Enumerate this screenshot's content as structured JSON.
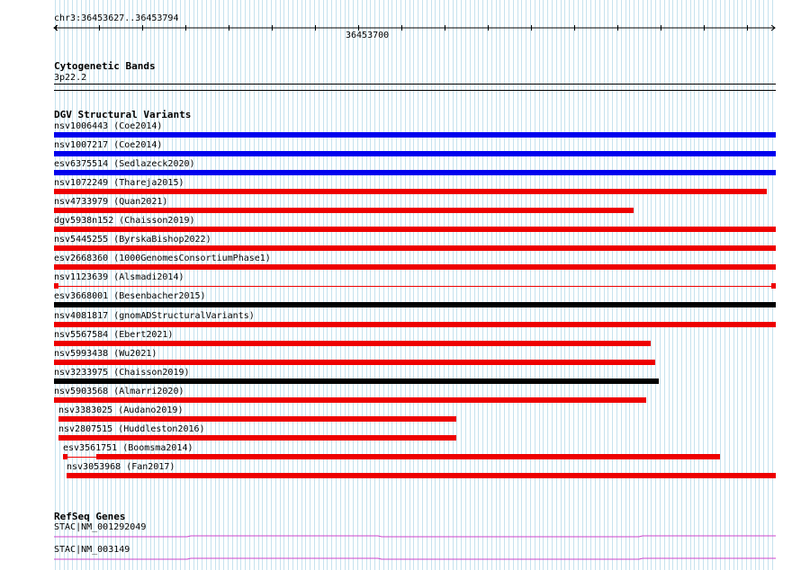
{
  "ruler": {
    "region": "chr3:36453627..36453794",
    "center_tick_label": "36453700"
  },
  "colors": {
    "grid_line": "#c6e2ee",
    "gain_blue": "#0000ee",
    "loss_red": "#ee0000",
    "complex_black": "#000000",
    "gene_magenta": "#cc44cc"
  },
  "cytoband_track": {
    "title": "Cytogenetic Bands",
    "band": "3p22.2"
  },
  "dgv_track": {
    "title": "DGV Structural Variants",
    "variants": [
      {
        "label": "nsv1006443 (Coe2014)",
        "start": 36453627,
        "end": 36453794,
        "type": "gain"
      },
      {
        "label": "nsv1007217 (Coe2014)",
        "start": 36453627,
        "end": 36453794,
        "type": "gain"
      },
      {
        "label": "esv6375514 (Sedlazeck2020)",
        "start": 36453627,
        "end": 36453794,
        "type": "gain"
      },
      {
        "label": "nsv1072249 (Thareja2015)",
        "start": 36453627,
        "end": 36453792,
        "type": "loss"
      },
      {
        "label": "nsv4733979 (Quan2021)",
        "start": 36453627,
        "end": 36453761,
        "type": "loss"
      },
      {
        "label": "dgv5938n152 (Chaisson2019)",
        "start": 36453627,
        "end": 36453794,
        "type": "loss"
      },
      {
        "label": "nsv5445255 (ByrskaBishop2022)",
        "start": 36453627,
        "end": 36453794,
        "type": "loss"
      },
      {
        "label": "esv2668360 (1000GenomesConsortiumPhase1)",
        "start": 36453627,
        "end": 36453794,
        "type": "loss"
      },
      {
        "label": "nsv1123639 (Alsmadi2014)",
        "start": 36453627,
        "end": 36453794,
        "type": "loss",
        "style": "split"
      },
      {
        "label": "esv3668001 (Besenbacher2015)",
        "start": 36453627,
        "end": 36453794,
        "type": "complex"
      },
      {
        "label": "nsv4081817 (gnomADStructuralVariants)",
        "start": 36453627,
        "end": 36453794,
        "type": "loss"
      },
      {
        "label": "nsv5567584 (Ebert2021)",
        "start": 36453627,
        "end": 36453765,
        "type": "loss"
      },
      {
        "label": "nsv5993438 (Wu2021)",
        "start": 36453627,
        "end": 36453766,
        "type": "loss"
      },
      {
        "label": "nsv3233975 (Chaisson2019)",
        "start": 36453627,
        "end": 36453767,
        "type": "complex"
      },
      {
        "label": "nsv5903568 (Almarri2020)",
        "start": 36453627,
        "end": 36453764,
        "type": "loss"
      },
      {
        "label": "nsv3383025 (Audano2019)",
        "start": 36453628,
        "end": 36453720,
        "type": "loss"
      },
      {
        "label": "nsv2807515 (Huddleston2016)",
        "start": 36453628,
        "end": 36453720,
        "type": "loss"
      },
      {
        "label": "esv3561751 (Boomsma2014)",
        "start": 36453629,
        "end": 36453781,
        "type": "loss",
        "style": "partial"
      },
      {
        "label": "nsv3053968 (Fan2017)",
        "start": 36453630,
        "end": 36453794,
        "type": "loss"
      }
    ]
  },
  "refseq_track": {
    "title": "RefSeq Genes",
    "genes": [
      {
        "label": "STAC|NM_001292049"
      },
      {
        "label": "STAC|NM_003149"
      }
    ]
  }
}
